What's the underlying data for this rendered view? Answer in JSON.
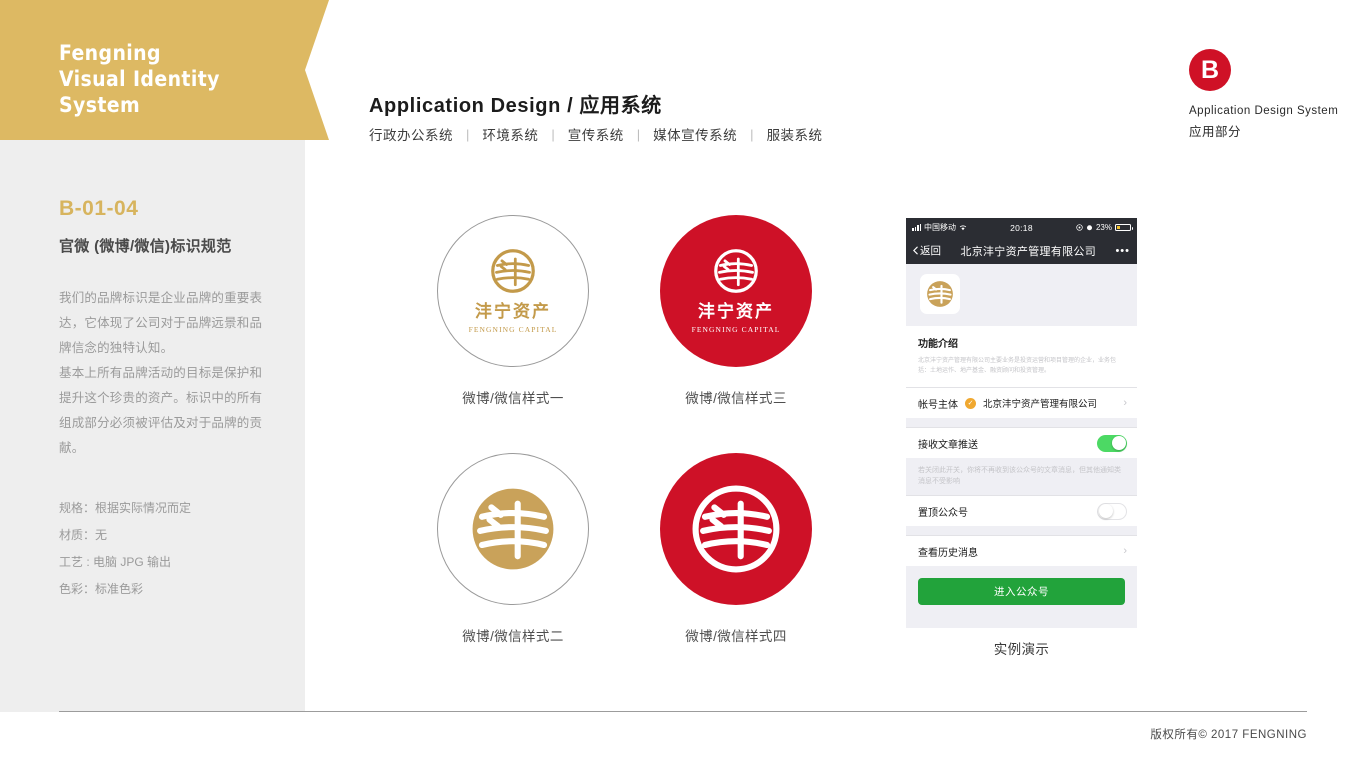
{
  "sidebar": {
    "brand_title": "Fengning\nVisual Identity\nSystem",
    "code": "B-01-04",
    "section_title": "官微 (微博/微信)标识规范",
    "body": "我们的品牌标识是企业品牌的重要表达，它体现了公司对于品牌远景和品牌信念的独特认知。\n基本上所有品牌活动的目标是保护和提升这个珍贵的资产。标识中的所有组成部分必须被评估及对于品牌的贡献。",
    "specs": [
      "规格：根据实际情况而定",
      "材质：无",
      "工艺 : 电脑 JPG 输出",
      "色彩：标准色彩"
    ]
  },
  "header": {
    "title": "Application  Design  /  应用系统",
    "nav": [
      "行政办公系统",
      "环境系统",
      "宣传系统",
      "媒体宣传系统",
      "服装系统"
    ],
    "nav_separator": "|"
  },
  "badge": {
    "letter": "B",
    "en": "Application  Design  System",
    "cn": "应用部分"
  },
  "logos": {
    "lockup_cn": "沣宁资产",
    "lockup_en": "FENGNING CAPITAL",
    "items": [
      {
        "caption": "微博/微信样式一",
        "style": "outline-gold"
      },
      {
        "caption": "微博/微信样式三",
        "style": "red-solid"
      },
      {
        "caption": "微博/微信样式二",
        "style": "outline-gold-markonly"
      },
      {
        "caption": "微博/微信样式四",
        "style": "red-solid-markonly"
      }
    ]
  },
  "phone": {
    "status": {
      "carrier": "中国移动",
      "time": "20:18",
      "battery_percent": "23%"
    },
    "nav": {
      "back": "返回",
      "title": "北京沣宁资产管理有限公司",
      "more": "•••"
    },
    "intro": {
      "heading": "功能介绍",
      "description": "北京沣宁资产管理有限公司主要业务是投资运营和项目管理的企业，业务包括：土地运作、地产基金、融资顾问和投资管理。"
    },
    "rows": {
      "account_label": "帐号主体",
      "account_value": "北京沣宁资产管理有限公司",
      "push_label": "接收文章推送",
      "push_hint": "若关闭此开关，你将不再收到该公众号的文章消息，但其他通知类消息不受影响",
      "pin_label": "置顶公众号",
      "history_label": "查看历史消息",
      "enter_button": "进入公众号"
    },
    "caption": "实例演示"
  },
  "footer": {
    "copyright": "版权所有©   2017  FENGNING"
  },
  "colors": {
    "gold": "#ddb963",
    "gold_ink": "#c39a4a",
    "red": "#ce1127",
    "badge_red": "#cf1126",
    "green": "#22a33b",
    "toggle_green": "#4cd964",
    "panel": "#eeeeee"
  }
}
